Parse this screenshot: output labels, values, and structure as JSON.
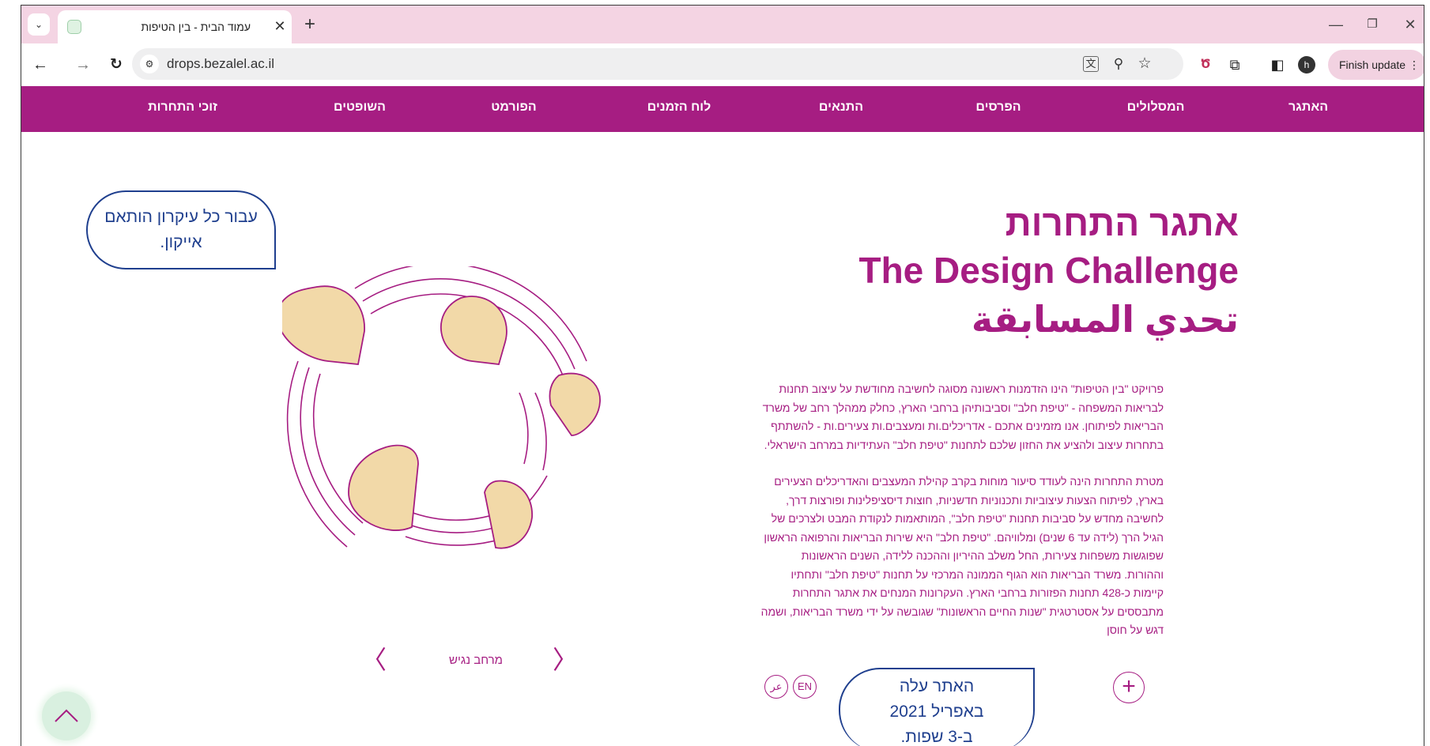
{
  "browser": {
    "tab_title": "עמוד הבית - בין הטיפות",
    "tab_close_glyph": "✕",
    "new_tab_glyph": "+",
    "url": "drops.bezalel.ac.il",
    "finish_update_label": "Finish update",
    "profile_initial": "h",
    "window_controls": {
      "minimize": "—",
      "maximize": "❐",
      "close": "✕"
    }
  },
  "site_nav": {
    "items": [
      {
        "label": "האתגר"
      },
      {
        "label": "המסלולים"
      },
      {
        "label": "הפרסים"
      },
      {
        "label": "התנאים"
      },
      {
        "label": "לוח הזמנים"
      },
      {
        "label": "הפורמט"
      },
      {
        "label": "השופטים"
      },
      {
        "label": "זוכי התחרות"
      }
    ]
  },
  "hero": {
    "title_he": "אתגר התחרות",
    "title_en": "The Design Challenge",
    "title_ar": "تحدي المسابقة"
  },
  "body": {
    "paragraph_1": "פרויקט \"בין הטיפות\" הינו הזדמנות ראשונה מסוגה לחשיבה מחודשת על עיצוב תחנות לבריאות המשפחה - \"טיפת חלב\" וסביבותיהן ברחבי הארץ, כחלק ממהלך רחב של משרד הבריאות לפיתוחן. אנו מזמינים אתכם - אדריכלים.ות ומעצבים.ות צעירים.ות - להשתתף בתחרות עיצוב ולהציע את החזון שלכם לתחנות \"טיפת חלב\" העתידיות במרחב הישראלי.",
    "paragraph_2": "מטרת התחרות הינה לעודד סיעור מוחות בקרב קהילת המעצבים והאדריכלים הצעירים בארץ, לפיתוח הצעות עיצוביות ותכנוניות חדשניות, חוצות דיסציפלינות ופורצות דרך, לחשיבה מחדש על סביבות תחנות \"טיפת חלב\", המותאמות לנקודת המבט ולצרכים של הגיל הרך (לידה עד 6 שנים) ומלוויהם. \"טיפת חלב\" היא שירות הבריאות והרפואה הראשון שפוגשות משפחות צעירות, החל משלב ההיריון וההכנה ללידה, השנים הראשונות וההורות. משרד הבריאות הוא הגוף הממונה המרכזי על תחנות \"טיפת חלב\" ותחתיו קיימות כ-428 תחנות הפזורות ברחבי הארץ. העקרונות המנחים את אתגר התחרות מתבססים על אסטרטגית \"שנות החיים הראשונות\" שגובשה על ידי משרד הבריאות, ושמה דגש על חוסן"
  },
  "illustration": {
    "caption": "מרחב נגיש",
    "prev_glyph": "〈",
    "next_glyph": "〉",
    "drop_fill": "#f2d9a8",
    "accent": "#a61d82"
  },
  "annotations": {
    "icon_note": "עבור כל עיקרון הותאם אייקון.",
    "launch_note_line1": "האתר עלה",
    "launch_note_line2": "באפריל 2021",
    "launch_note_line3": "ב-3 שפות."
  },
  "language_switch": {
    "arabic": "عر",
    "english": "EN"
  },
  "plus_glyph": "+",
  "colors": {
    "brand": "#a61d82",
    "tab_strip": "#f4d4e3",
    "annotation_blue": "#1f3f8e",
    "scroll_btn": "#d9f0e0"
  }
}
